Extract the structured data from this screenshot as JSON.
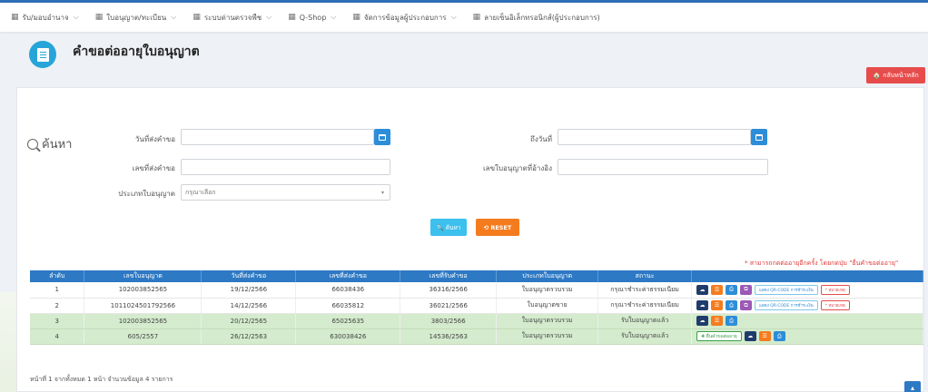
{
  "nav": {
    "items": [
      {
        "label": "รับ/มอบอำนาจ"
      },
      {
        "label": "ใบอนุญาต/ทะเบียน"
      },
      {
        "label": "ระบบด่านตรวจพืช"
      },
      {
        "label": "Q-Shop"
      },
      {
        "label": "จัดการข้อมูลผู้ประกอบการ"
      },
      {
        "label": "ลายเซ็นอิเล็กทรอนิกส์(ผู้ประกอบการ)"
      }
    ]
  },
  "header": {
    "title": "คำขอต่ออายุใบอนุญาต",
    "back_label": "🏠 กลับหน้าหลัก"
  },
  "search": {
    "heading": "ค้นหา",
    "submit_date_label": "วันที่ส่งคำขอ",
    "to_date_label": "ถึงวันที่",
    "request_no_label": "เลขที่ส่งคำขอ",
    "ref_license_label": "เลขใบอนุญาตที่อ้างอิง",
    "license_type_label": "ประเภทใบอนุญาต",
    "license_type_value": "กรุณาเลือก",
    "search_button": "🔍 ค้นหา",
    "reset_button": "⟲ RESET"
  },
  "note": "* สามารถกดต่ออายุอีกครั้ง โดยกดปุ่ม \"ยื่นคำขอต่ออายุ\"",
  "table": {
    "headers": [
      "ลำดับ",
      "เลขใบอนุญาต",
      "วันที่ส่งคำขอ",
      "เลขที่ส่งคำขอ",
      "เลขที่รับคำขอ",
      "ประเภทใบอนุญาต",
      "สถานะ",
      ""
    ],
    "rows": [
      {
        "no": "1",
        "license": "102003852565",
        "date": "19/12/2566",
        "req": "66038436",
        "recv": "36316/2566",
        "type": "ใบอนุญาตรวบรวม",
        "status": "กรุณาชำระค่าธรรมเนียม"
      },
      {
        "no": "2",
        "license": "1011024501792566",
        "date": "14/12/2566",
        "req": "66035812",
        "recv": "36021/2566",
        "type": "ใบอนุญาตขาย",
        "status": "กรุณาชำระค่าธรรมเนียม"
      },
      {
        "no": "3",
        "license": "102003852565",
        "date": "20/12/2565",
        "req": "65025635",
        "recv": "3803/2566",
        "type": "ใบอนุญาตรวบรวม",
        "status": "รับใบอนุญาตแล้ว"
      },
      {
        "no": "4",
        "license": "605/2557",
        "date": "26/12/2563",
        "req": "630038426",
        "recv": "14536/2563",
        "type": "ใบอนุญาตรวบรวม",
        "status": "รับใบอนุญาตแล้ว"
      }
    ],
    "qr_label": "แสดง QR-CODE การชำระเงิน",
    "remark_label": "* หมายเหตุ",
    "renew_label": "✚ ยื่นคำขอต่ออายุ"
  },
  "pager": {
    "info": "หน้าที่ 1 จากทั้งหมด 1 หน้า จำนวนข้อมูล 4 รายการ"
  }
}
